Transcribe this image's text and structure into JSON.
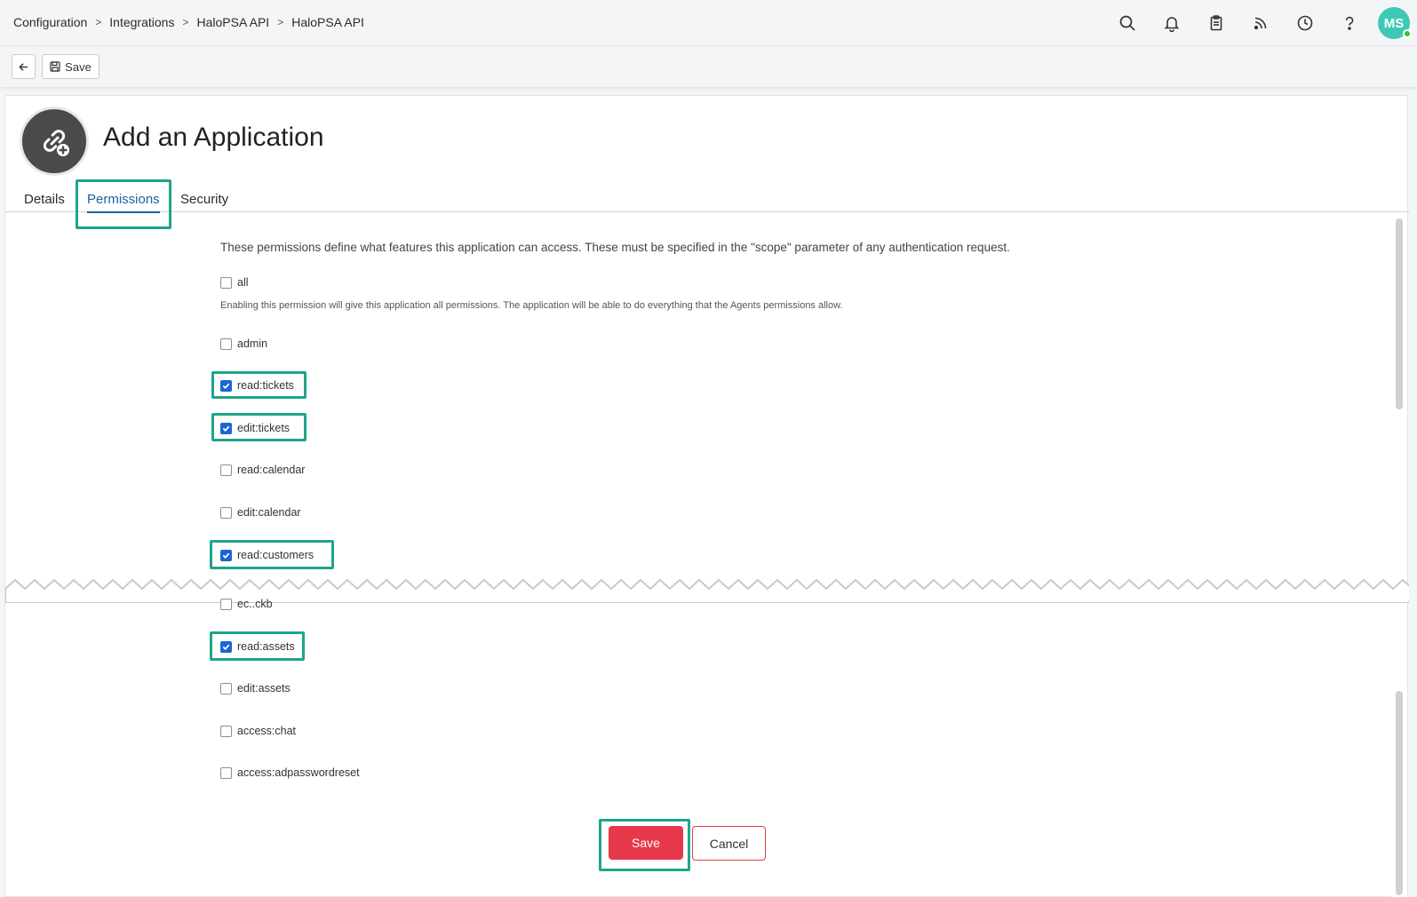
{
  "breadcrumb": [
    "Configuration",
    "Integrations",
    "HaloPSA API",
    "HaloPSA API"
  ],
  "topbar": {
    "icons": [
      "search-icon",
      "bell-icon",
      "clipboard-icon",
      "rss-icon",
      "clock-icon",
      "help-icon"
    ],
    "avatar_initials": "MS"
  },
  "toolbar": {
    "save_label": "Save"
  },
  "page": {
    "title": "Add an Application"
  },
  "tabs": [
    {
      "label": "Details"
    },
    {
      "label": "Permissions"
    },
    {
      "label": "Security"
    }
  ],
  "permissions": {
    "intro": "These permissions define what features this application can access. These must be specified in the \"scope\" parameter of any authentication request.",
    "all_note": "Enabling this permission will give this application all permissions. The application will be able to do everything that the Agents permissions allow.",
    "items": [
      {
        "label": "all",
        "checked": false
      },
      {
        "label": "admin",
        "checked": false
      },
      {
        "label": "read:tickets",
        "checked": true
      },
      {
        "label": "edit:tickets",
        "checked": true
      },
      {
        "label": "read:calendar",
        "checked": false
      },
      {
        "label": "edit:calendar",
        "checked": false
      },
      {
        "label": "read:customers",
        "checked": true
      },
      {
        "label": "ec..ckb",
        "checked": false
      },
      {
        "label": "read:assets",
        "checked": true
      },
      {
        "label": "edit:assets",
        "checked": false
      },
      {
        "label": "access:chat",
        "checked": false
      },
      {
        "label": "access:adpasswordreset",
        "checked": false
      }
    ]
  },
  "footer": {
    "save_label": "Save",
    "cancel_label": "Cancel"
  },
  "colors": {
    "accent": "#1f5fa8",
    "highlight": "#1ea58a",
    "danger": "#e8384c",
    "checkbox": "#1a66d6",
    "avatar": "#3ec9b5"
  }
}
